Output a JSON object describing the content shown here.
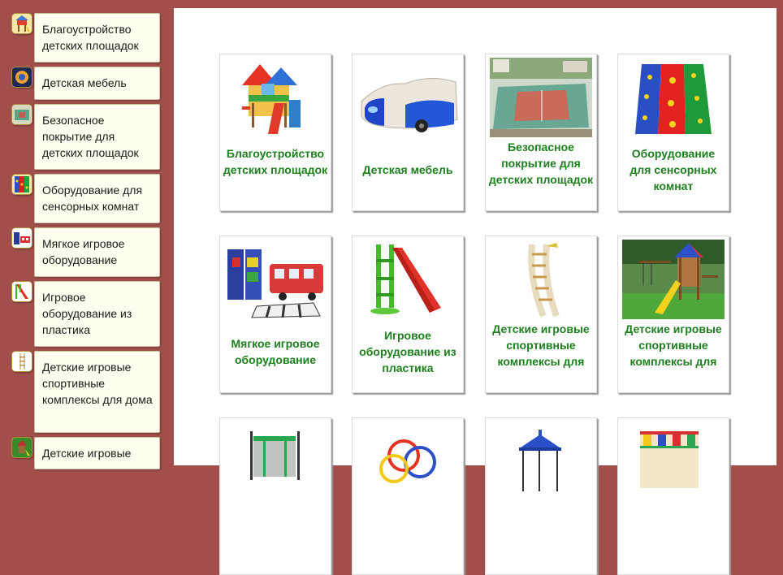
{
  "sidebar": {
    "items": [
      {
        "label": "Благоустройство детских площадок",
        "icon": "playground-icon"
      },
      {
        "label": "Детская мебель",
        "icon": "furniture-icon"
      },
      {
        "label": "Безопасное покрытие для детских площадок",
        "icon": "court-icon"
      },
      {
        "label": "Оборудование для сенсорных комнат",
        "icon": "sensory-mat-icon"
      },
      {
        "label": "Мягкое игровое оборудование",
        "icon": "soft-toys-icon"
      },
      {
        "label": "Игровое оборудование из пластика",
        "icon": "plastic-slide-icon"
      },
      {
        "label": "Детские игровые спортивные комплексы для дома",
        "icon": "ladder-icon"
      },
      {
        "label": "Детские игровые",
        "icon": "outdoor-complex-icon"
      }
    ]
  },
  "catalog": {
    "cards": [
      {
        "label": "Благоустройство детских площадок",
        "image": "playground-house-image"
      },
      {
        "label": "Детская мебель",
        "image": "car-bed-image"
      },
      {
        "label": "Безопасное покрытие для детских площадок",
        "image": "sports-court-image"
      },
      {
        "label": "Оборудование для сенсорных комнат",
        "image": "sensory-mat-image"
      },
      {
        "label": "Мягкое игровое оборудование",
        "image": "soft-blocks-image"
      },
      {
        "label": "Игровое оборудование из пластика",
        "image": "plastic-slide-image"
      },
      {
        "label": "Детские игровые спортивные комплексы для",
        "image": "wall-ladder-image"
      },
      {
        "label": "Детские игровые спортивные комплексы для",
        "image": "outdoor-complex-image"
      },
      {
        "label": "",
        "image": "trampoline-image"
      },
      {
        "label": "",
        "image": "rings-image"
      },
      {
        "label": "",
        "image": "gazebo-image"
      },
      {
        "label": "",
        "image": "indoor-playground-image"
      }
    ]
  },
  "colors": {
    "background": "#a24f4c",
    "sidebar_box": "#fffff0",
    "card_label": "#1d7f1d"
  }
}
